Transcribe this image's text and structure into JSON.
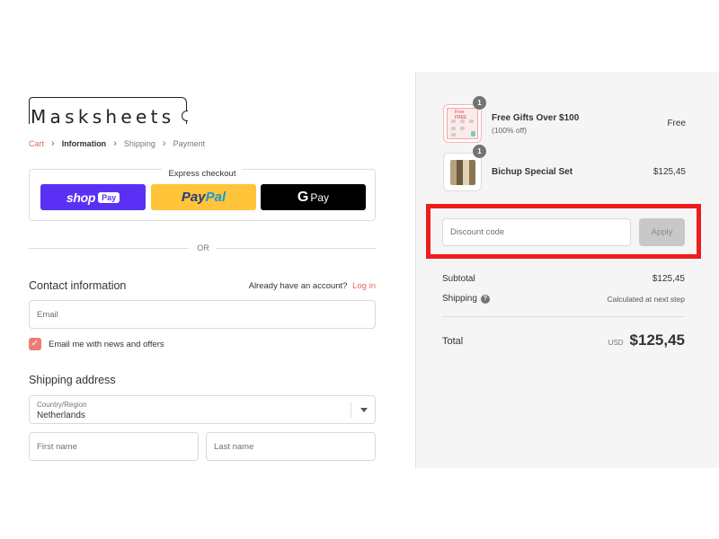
{
  "brand": {
    "logo_text": "Masksheets"
  },
  "breadcrumb": {
    "cart": "Cart",
    "information": "Information",
    "shipping": "Shipping",
    "payment": "Payment"
  },
  "express_checkout": {
    "title": "Express checkout",
    "shop_pay": {
      "word": "shop",
      "tag": "Pay"
    },
    "paypal": {
      "pay": "Pay",
      "pal": "Pal"
    },
    "gpay": {
      "g": "G",
      "pay": "Pay"
    }
  },
  "divider_text": "OR",
  "contact": {
    "title": "Contact information",
    "account_prompt": "Already have an account?",
    "login_link": "Log in",
    "email_placeholder": "Email",
    "newsletter_label": "Email me with news and offers",
    "newsletter_checked": true
  },
  "shipping_address": {
    "title": "Shipping address",
    "country_label": "Country/Region",
    "country_value": "Netherlands",
    "first_name_placeholder": "First name",
    "last_name_placeholder": "Last name"
  },
  "order_summary": {
    "items": [
      {
        "name": "Free Gifts Over $100",
        "subtitle": "(100% off)",
        "price": "Free",
        "quantity": "1",
        "thumb_text": "Free FREE"
      },
      {
        "name": "Bichup Special Set",
        "subtitle": "",
        "price": "$125,45",
        "quantity": "1"
      }
    ],
    "discount_placeholder": "Discount code",
    "apply_label": "Apply",
    "subtotal_label": "Subtotal",
    "subtotal_value": "$125,45",
    "shipping_label": "Shipping",
    "shipping_value": "Calculated at next step",
    "total_label": "Total",
    "currency": "USD",
    "total_value": "$125,45"
  },
  "colors": {
    "accent": "#e06a64",
    "checkbox": "#ea7e77",
    "shop_pay": "#5a31f4",
    "paypal": "#ffc439",
    "highlight": "#ee1c1c"
  }
}
